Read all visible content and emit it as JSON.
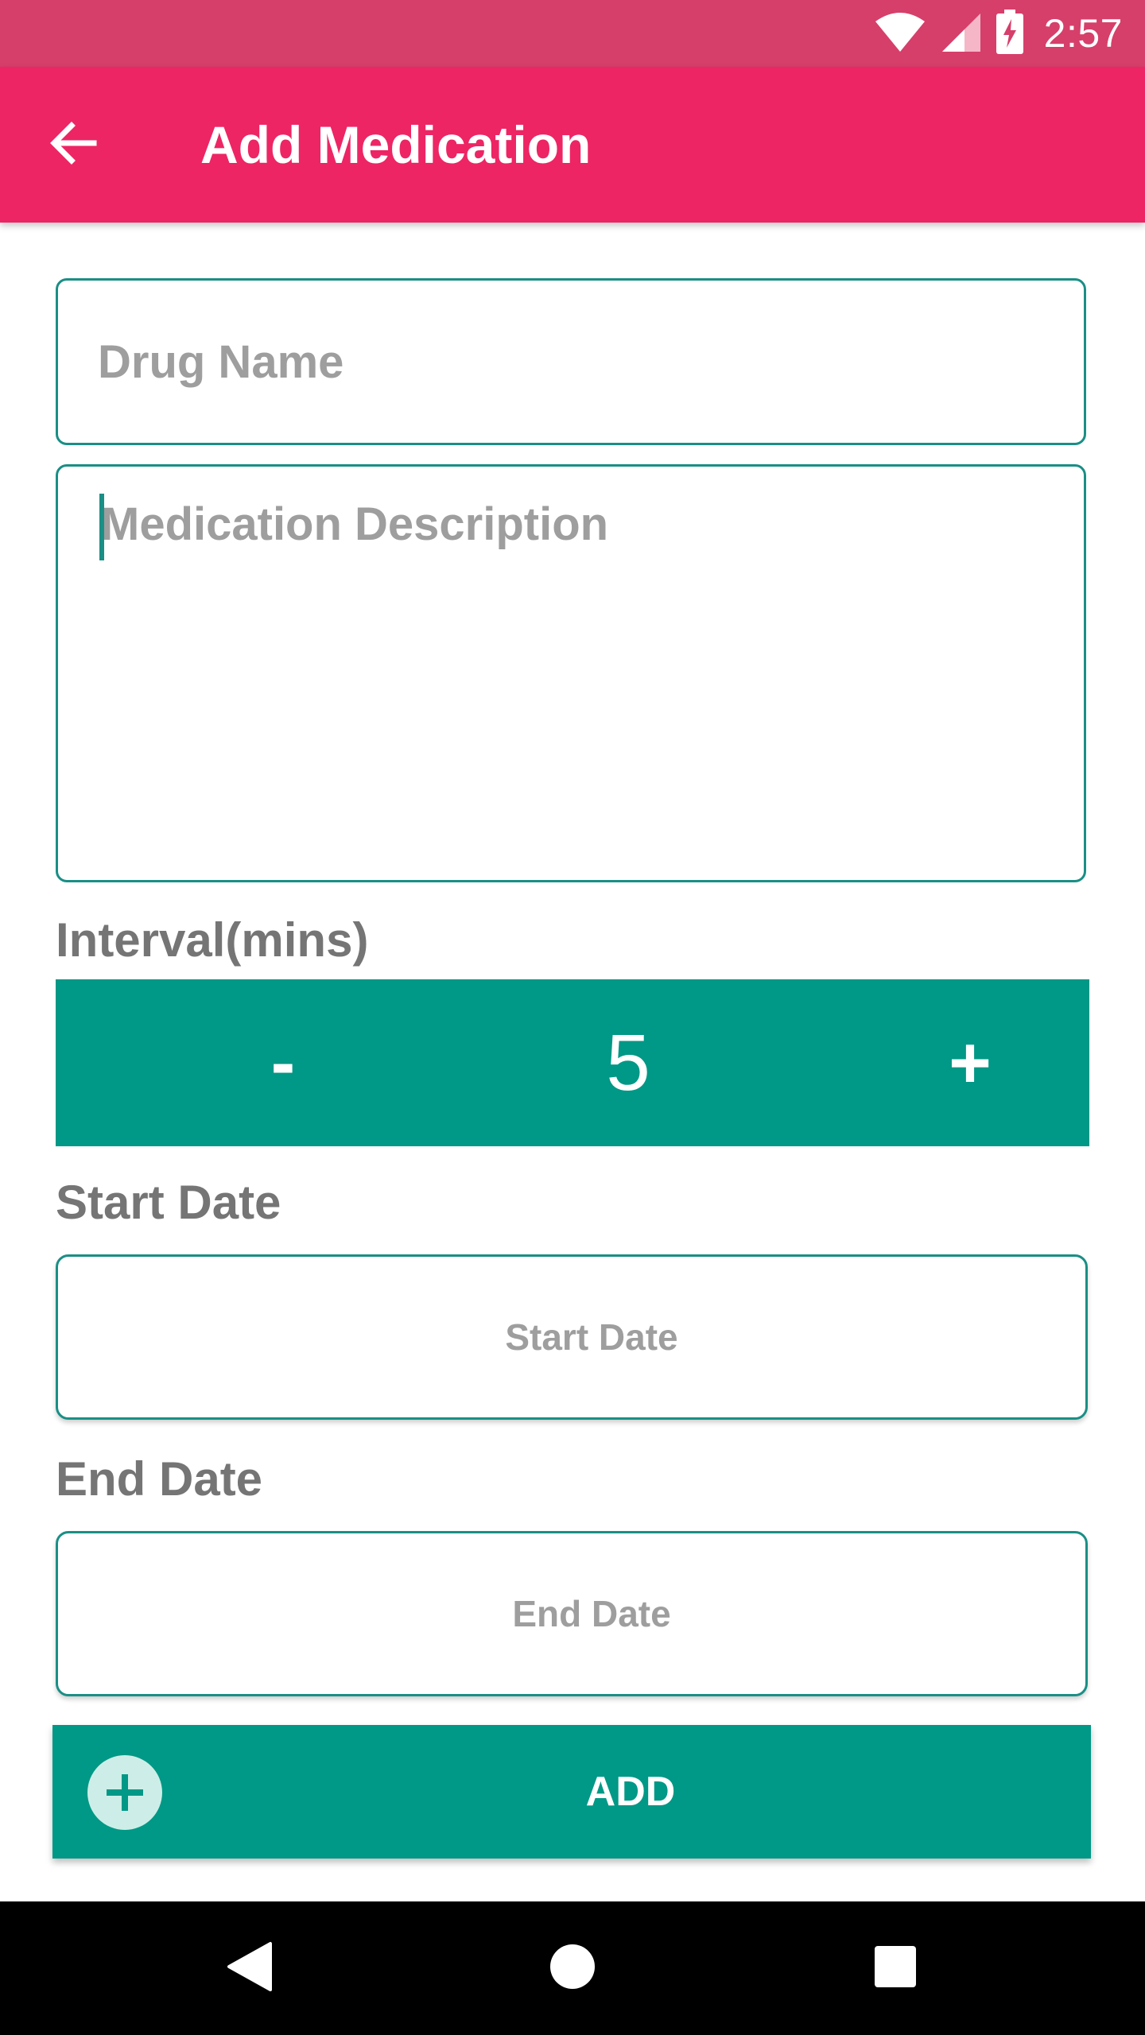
{
  "status_bar": {
    "time": "2:57",
    "icons": [
      "wifi-icon",
      "cell-signal-icon",
      "battery-charging-icon"
    ]
  },
  "app_bar": {
    "title": "Add Medication",
    "back_icon": "arrow-back-icon"
  },
  "form": {
    "drug_name": {
      "placeholder": "Drug Name",
      "value": ""
    },
    "medication_description": {
      "placeholder": "Medication Description",
      "value": ""
    },
    "interval": {
      "label": "Interval(mins)",
      "decrement_label": "-",
      "value": "5",
      "increment_label": "+"
    },
    "start_date": {
      "label": "Start Date",
      "button_label": "Start Date"
    },
    "end_date": {
      "label": "End Date",
      "button_label": "End Date"
    },
    "add_button": {
      "label": "ADD",
      "icon": "plus-circle-icon"
    }
  },
  "nav_bar": {
    "icons": [
      "back-triangle-icon",
      "home-circle-icon",
      "recents-square-icon"
    ]
  },
  "colors": {
    "status_bar": "#d63f6a",
    "app_bar": "#ed2565",
    "accent": "#009886",
    "field_border": "#1a8f86",
    "label_text": "#757575",
    "placeholder_text": "#9e9e9e"
  }
}
